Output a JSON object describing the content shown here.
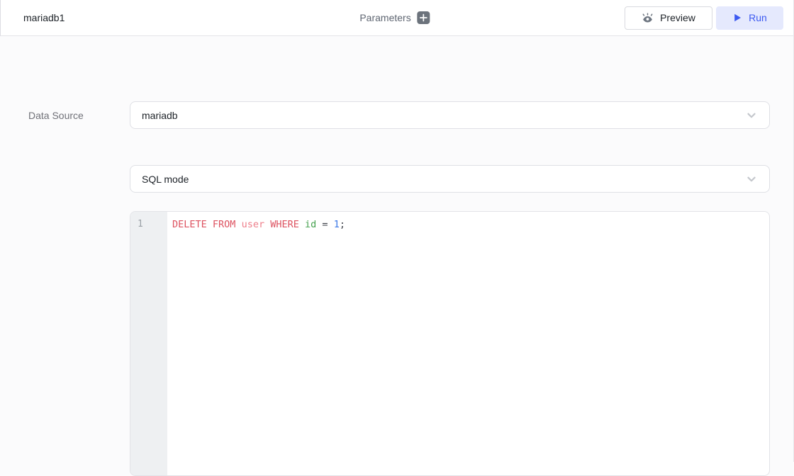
{
  "header": {
    "title": "mariadb1",
    "parameters_label": "Parameters",
    "preview_label": "Preview",
    "run_label": "Run"
  },
  "form": {
    "data_source_label": "Data Source",
    "data_source_value": "mariadb",
    "mode_value": "SQL mode"
  },
  "editor": {
    "line_number": "1",
    "code_text": "DELETE FROM user WHERE id = 1;",
    "tokens": [
      {
        "text": "DELETE",
        "type": "keyword"
      },
      {
        "text": "FROM",
        "type": "keyword"
      },
      {
        "text": "user",
        "type": "table"
      },
      {
        "text": "WHERE",
        "type": "keyword"
      },
      {
        "text": "id",
        "type": "column"
      },
      {
        "text": "=",
        "type": "operator"
      },
      {
        "text": "1",
        "type": "number"
      },
      {
        "text": ";",
        "type": "punctuation"
      }
    ]
  },
  "icons": {
    "add_parameter": "plus-icon",
    "preview": "eye-icon",
    "run": "play-icon",
    "dropdown": "chevron-down-icon"
  },
  "colors": {
    "accent_blue": "#3d5af1",
    "run_button_bg": "#e5e9fd",
    "keyword_red": "#dd5260",
    "table_pink": "#ee7e8a",
    "column_green": "#43a04c",
    "number_blue": "#3b78e7",
    "gutter_bg": "#eef0f2",
    "page_bg": "#fbfbfc"
  }
}
